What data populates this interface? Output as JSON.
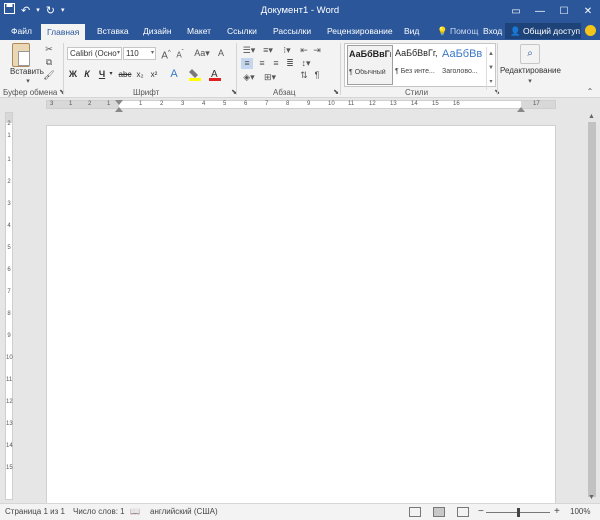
{
  "titlebar": {
    "document_title": "Документ1 - Word",
    "qat": {
      "save_icon": "save-icon",
      "undo_icon": "undo-icon",
      "redo_icon": "redo-icon",
      "customize_icon": "customize-qat-icon"
    },
    "window_buttons": {
      "ribbon_options": "ribbon-display-options-icon",
      "minimize": "minimize-icon",
      "maximize": "maximize-icon",
      "close": "close-icon"
    }
  },
  "tabs": {
    "file": "Файл",
    "home": "Главная",
    "insert": "Вставка",
    "design": "Дизайн",
    "layout": "Макет",
    "references": "Ссылки",
    "mailings": "Рассылки",
    "review": "Рецензирование",
    "view": "Вид",
    "help": "Помощ",
    "signin": "Вход",
    "share": "Общий доступ"
  },
  "ribbon": {
    "clipboard": {
      "paste": "Вставить",
      "label": "Буфер обмена"
    },
    "font": {
      "font_name": "Calibri (Осно",
      "font_size": "110",
      "label": "Шрифт",
      "bold": "Ж",
      "italic": "К",
      "underline": "Ч",
      "strike": "abc",
      "subscript": "x₂",
      "superscript": "x²",
      "grow": "A",
      "shrink": "A",
      "change_case": "Aa",
      "clear_format": "A"
    },
    "paragraph": {
      "label": "Абзац"
    },
    "styles": {
      "label": "Стили",
      "items": [
        {
          "sample": "АаБбВвГг,",
          "name": "¶ Обычный"
        },
        {
          "sample": "АаБбВвГг,",
          "name": "¶ Без инте..."
        },
        {
          "sample": "АаБбВв",
          "name": "Заголово..."
        }
      ]
    },
    "editing": {
      "label": "Редактирование"
    }
  },
  "ruler": {
    "ticks": [
      "3",
      "1",
      "2",
      "1",
      "1",
      "2",
      "3",
      "4",
      "5",
      "6",
      "7",
      "8",
      "9",
      "10",
      "11",
      "12",
      "13",
      "14",
      "15",
      "16",
      "17"
    ],
    "vticks": [
      "2",
      "1",
      "1",
      "2",
      "3",
      "4",
      "5",
      "6",
      "7",
      "8",
      "9",
      "10",
      "11",
      "12",
      "13",
      "14",
      "15"
    ]
  },
  "statusbar": {
    "page": "Страница 1 из 1",
    "words": "Число слов: 1",
    "language": "английский (США)",
    "zoom_minus": "−",
    "zoom_plus": "+",
    "zoom": "100%"
  },
  "colors": {
    "accent": "#2b579a",
    "highlight": "#ffff00",
    "font_color": "#e02020"
  }
}
